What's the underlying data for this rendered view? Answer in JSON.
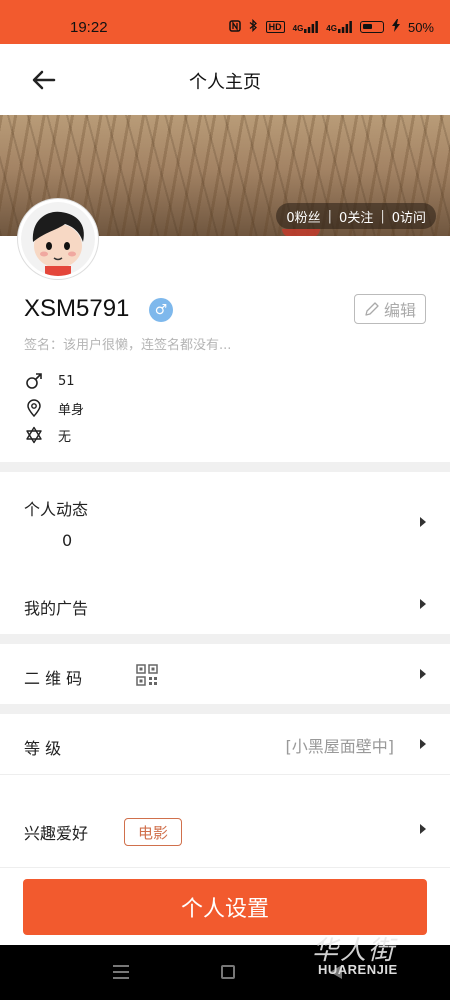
{
  "status_bar": {
    "time": "19:22",
    "icons": [
      "nfc-icon",
      "bluetooth-icon",
      "hd-icon",
      "signal-4g-icon",
      "signal-4g-icon",
      "battery-icon",
      "charging-icon"
    ],
    "hd": "HD",
    "net1": "4G",
    "net2": "4G",
    "battery_percent": "50%",
    "battery_level": 0.5
  },
  "header": {
    "title": "个人主页",
    "back_icon": "arrow-left-icon"
  },
  "profile": {
    "fans": "0粉丝",
    "following": "0关注",
    "visits": "0访问",
    "separator": "|",
    "username": "XSM5791",
    "gender_symbol": "♂",
    "edit_label": "编辑",
    "signature": "签名：该用户很懒，连签名都没有...",
    "age": "51",
    "marital": "单身",
    "extra": "无"
  },
  "menu": {
    "moments_label": "个人动态",
    "moments_count": "0",
    "ads_label": "我的广告",
    "qr_label": "二  维  码",
    "level_label": "等        级",
    "level_value": "[小黑屋面壁中]",
    "hobby_label": "兴趣爱好",
    "hobby_tag": "电影"
  },
  "footer": {
    "settings_label": "个人设置"
  },
  "watermark": {
    "cn": "华人街",
    "en": "HUARENJIE"
  },
  "colors": {
    "accent": "#f25a2e",
    "tag": "#d0704c",
    "gender_badge": "#7eb8ec"
  }
}
